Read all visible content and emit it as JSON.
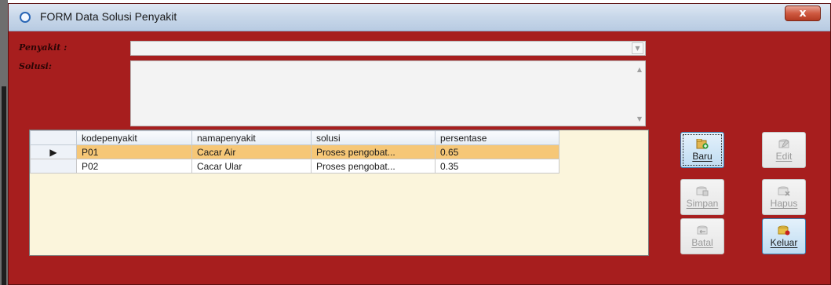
{
  "window": {
    "title": "FORM Data Solusi Penyakit",
    "close_symbol": "x"
  },
  "form": {
    "penyakit_label": "Penyakit :",
    "penyakit_value": "",
    "solusi_label": "Solusi:",
    "solusi_value": ""
  },
  "grid": {
    "columns": [
      "kodepenyakit",
      "namapenyakit",
      "solusi",
      "persentase"
    ],
    "rows": [
      {
        "kodepenyakit": "P01",
        "namapenyakit": "Cacar Air",
        "solusi": "Proses pengobat...",
        "persentase": "0.65",
        "selected": true
      },
      {
        "kodepenyakit": "P02",
        "namapenyakit": "Cacar Ular",
        "solusi": "Proses pengobat...",
        "persentase": "0.35",
        "selected": false
      }
    ],
    "current_row_marker": "▶"
  },
  "buttons": {
    "baru": {
      "label": "Baru",
      "enabled": true,
      "icon": "new-file-icon"
    },
    "edit": {
      "label": "Edit",
      "enabled": false,
      "icon": "edit-icon"
    },
    "simpan": {
      "label": "Simpan",
      "enabled": false,
      "icon": "save-icon"
    },
    "hapus": {
      "label": "Hapus",
      "enabled": false,
      "icon": "delete-icon"
    },
    "batal": {
      "label": "Batal",
      "enabled": false,
      "icon": "undo-icon"
    },
    "keluar": {
      "label": "Keluar",
      "enabled": true,
      "icon": "exit-icon"
    }
  },
  "colors": {
    "form_background": "#a71e1e",
    "selected_row": "#f6c777",
    "grid_background": "#fbf5dc"
  }
}
